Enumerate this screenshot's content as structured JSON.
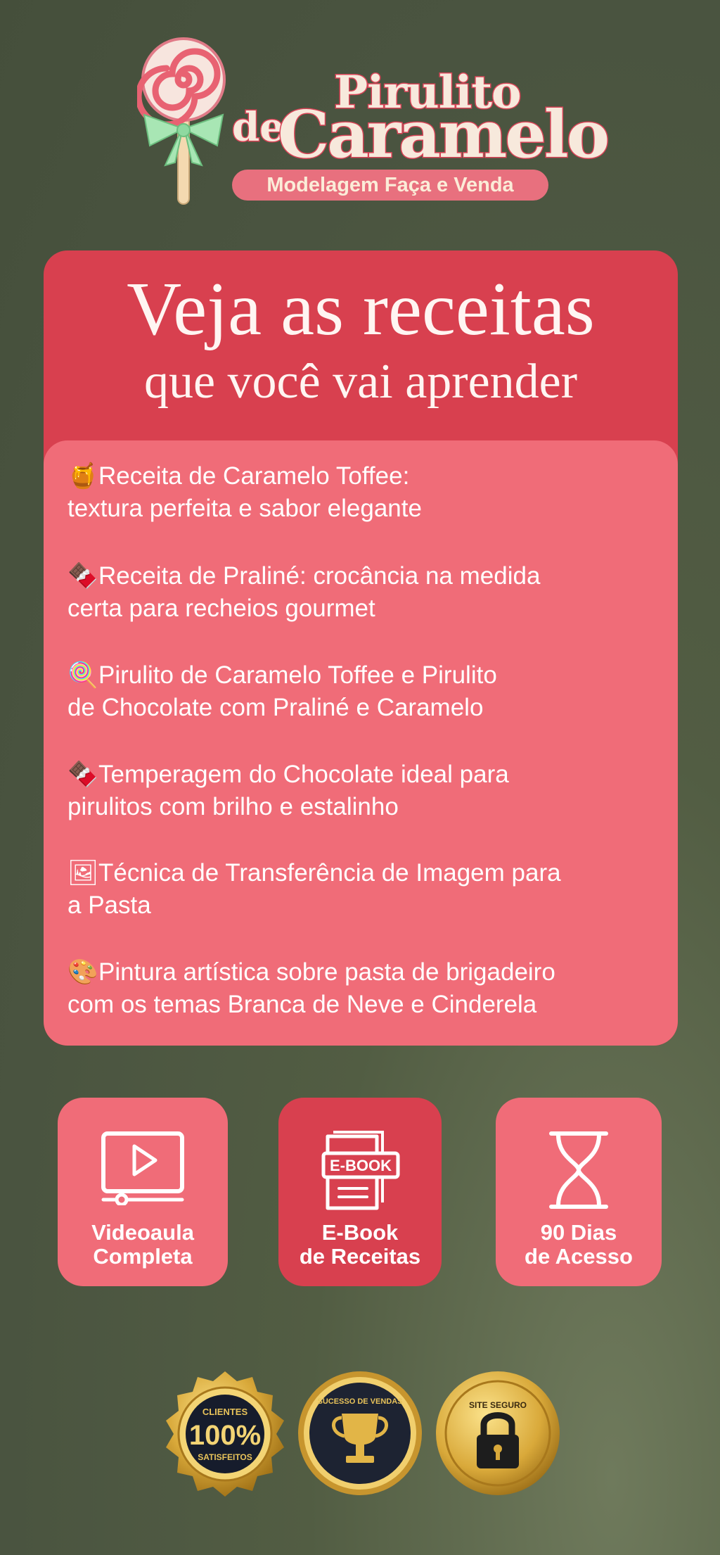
{
  "brand": {
    "line1": "Pirulito",
    "line_de": "de",
    "line2": "Caramelo",
    "tagline": "Modelagem Faça e Venda"
  },
  "recipes": {
    "title": "Veja as receitas",
    "subtitle": "que você vai aprender",
    "items": [
      {
        "icon": "honey-pot-icon",
        "glyph": "🍯",
        "line1": "Receita de Caramelo Toffee:",
        "line2": "textura perfeita e sabor elegante"
      },
      {
        "icon": "chocolate-bar-icon",
        "glyph": "🍫",
        "line1": "Receita de Praliné: crocância na medida",
        "line2": "certa para recheios gourmet"
      },
      {
        "icon": "lollipop-icon",
        "glyph": "🍭",
        "line1": "Pirulito de Caramelo Toffee e Pirulito",
        "line2": "de Chocolate com Praliné e Caramelo"
      },
      {
        "icon": "chocolate-bar-icon",
        "glyph": "🍫",
        "line1": "Temperagem do Chocolate ideal para",
        "line2": "pirulitos com brilho e estalinho"
      },
      {
        "icon": "framed-picture-icon",
        "glyph": "🖼",
        "line1": "Técnica de Transferência de Imagem para",
        "line2": "a Pasta"
      },
      {
        "icon": "artist-palette-icon",
        "glyph": "🎨",
        "line1": "Pintura artística sobre pasta de brigadeiro",
        "line2": "com os temas Branca de Neve e Cinderela"
      }
    ]
  },
  "features": [
    {
      "icon": "video-player-icon",
      "line1": "Videoaula",
      "line2": "Completa"
    },
    {
      "icon": "ebook-icon",
      "icon_text": "E-BOOK",
      "line1": "E-Book",
      "line2": "de Receitas"
    },
    {
      "icon": "hourglass-icon",
      "line1": "90 Dias",
      "line2": "de Acesso"
    }
  ],
  "seals": [
    {
      "icon": "satisfaction-seal",
      "top": "CLIENTES",
      "big": "100%",
      "bottom": "SATISFEITOS"
    },
    {
      "icon": "trophy-seal",
      "top": "SUCESSO DE VENDAS"
    },
    {
      "icon": "secure-site-seal",
      "top": "SITE SEGURO"
    }
  ],
  "colors": {
    "background": "#4a5440",
    "red": "#d8404f",
    "pink": "#f06c78",
    "cream": "#f7e9dc",
    "gold": "#d9a93a"
  }
}
